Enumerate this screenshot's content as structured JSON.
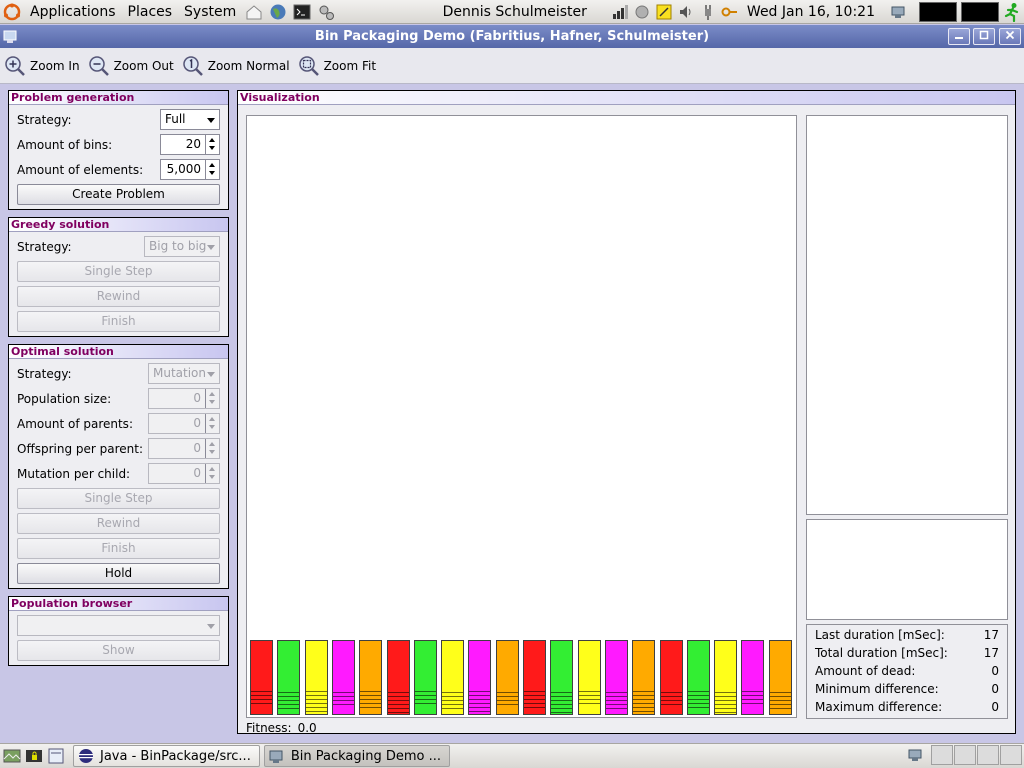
{
  "top_panel": {
    "menus": [
      "Applications",
      "Places",
      "System"
    ],
    "user": "Dennis Schulmeister",
    "clock": "Wed Jan 16, 10:21"
  },
  "window": {
    "title": "Bin Packaging Demo (Fabritius, Hafner, Schulmeister)"
  },
  "toolbar": {
    "zoom_in": "Zoom In",
    "zoom_out": "Zoom Out",
    "zoom_normal": "Zoom Normal",
    "zoom_fit": "Zoom Fit"
  },
  "problem_generation": {
    "title": "Problem generation",
    "strategy_label": "Strategy:",
    "strategy_value": "Full",
    "bins_label": "Amount of bins:",
    "bins_value": "20",
    "elements_label": "Amount of elements:",
    "elements_value": "5,000",
    "create_button": "Create Problem"
  },
  "greedy_solution": {
    "title": "Greedy solution",
    "strategy_label": "Strategy:",
    "strategy_value": "Big to big",
    "single_step": "Single Step",
    "rewind": "Rewind",
    "finish": "Finish"
  },
  "optimal_solution": {
    "title": "Optimal solution",
    "strategy_label": "Strategy:",
    "strategy_value": "Mutation",
    "population_label": "Population size:",
    "population_value": "0",
    "parents_label": "Amount of parents:",
    "parents_value": "0",
    "offspring_label": "Offspring per parent:",
    "offspring_value": "0",
    "mutation_label": "Mutation per child:",
    "mutation_value": "0",
    "single_step": "Single Step",
    "rewind": "Rewind",
    "finish": "Finish",
    "hold": "Hold"
  },
  "population_browser": {
    "title": "Population browser",
    "show": "Show"
  },
  "visualization": {
    "title": "Visualization",
    "fitness_label": "Fitness:",
    "fitness_value": "0.0",
    "stats": [
      {
        "label": "Last duration [mSec]:",
        "value": "17"
      },
      {
        "label": "Total duration [mSec]:",
        "value": "17"
      },
      {
        "label": "Amount of dead:",
        "value": "0"
      },
      {
        "label": "Minimum difference:",
        "value": "0"
      },
      {
        "label": "Maximum difference:",
        "value": "0"
      }
    ],
    "bin_colors": [
      "#ff1a1a",
      "#33ee33",
      "#ffff1a",
      "#ff1aff",
      "#ffaa00",
      "#ff1a1a",
      "#33ee33",
      "#ffff1a",
      "#ff1aff",
      "#ffaa00",
      "#ff1a1a",
      "#33ee33",
      "#ffff1a",
      "#ff1aff",
      "#ffaa00",
      "#ff1a1a",
      "#33ee33",
      "#ffff1a",
      "#ff1aff",
      "#ffaa00"
    ]
  },
  "taskbar": {
    "tasks": [
      "Java - BinPackage/src...",
      "Bin Packaging Demo ..."
    ]
  }
}
